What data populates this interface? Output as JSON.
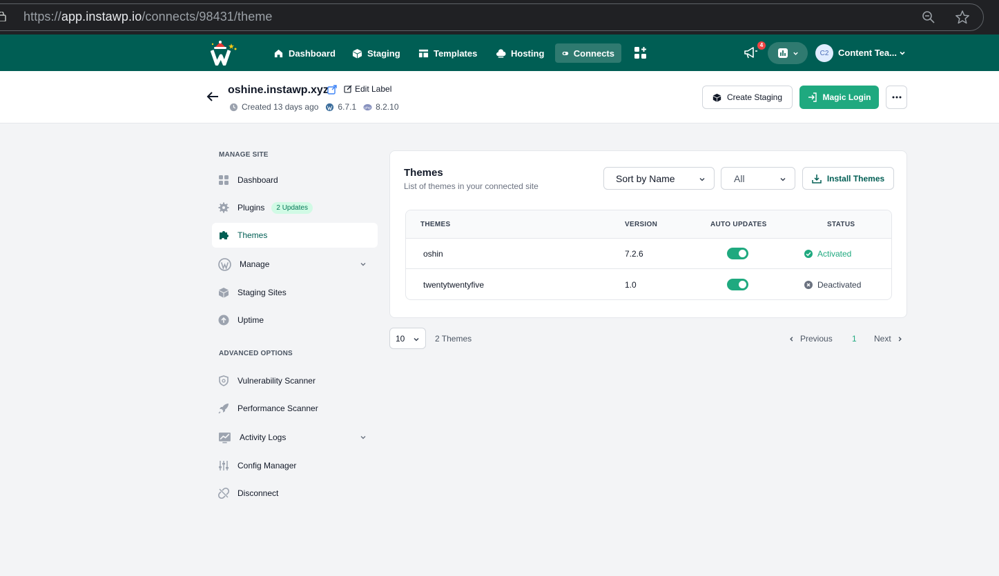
{
  "browser": {
    "url_prefix": "https://",
    "url_host": "app.instawp.io",
    "url_path": "/connects/98431/theme"
  },
  "topnav": {
    "items": [
      {
        "label": "Dashboard",
        "icon": "home-icon"
      },
      {
        "label": "Staging",
        "icon": "cube-icon"
      },
      {
        "label": "Templates",
        "icon": "template-icon"
      },
      {
        "label": "Hosting",
        "icon": "cloud-icon"
      },
      {
        "label": "Connects",
        "icon": "connects-icon",
        "active": true
      }
    ],
    "notification_count": "4",
    "avatar_initials": "C2",
    "user_name": "Content Tea..."
  },
  "site": {
    "title": "oshine.instawp.xyz",
    "edit_label": "Edit Label",
    "created": "Created 13 days ago",
    "wp_version": "6.7.1",
    "php_version": "8.2.10",
    "create_staging_label": "Create Staging",
    "magic_login_label": "Magic Login"
  },
  "sidebar": {
    "manage_heading": "MANAGE SITE",
    "manage_items": [
      {
        "label": "Dashboard",
        "icon": "grid-icon"
      },
      {
        "label": "Plugins",
        "icon": "gear-icon",
        "badge": "2 Updates"
      },
      {
        "label": "Themes",
        "icon": "puzzle-icon",
        "active": true
      },
      {
        "label": "Manage",
        "icon": "wordpress-icon",
        "expandable": true
      },
      {
        "label": "Staging Sites",
        "icon": "cube-icon"
      },
      {
        "label": "Uptime",
        "icon": "uptime-icon"
      }
    ],
    "advanced_heading": "ADVANCED OPTIONS",
    "advanced_items": [
      {
        "label": "Vulnerability Scanner",
        "icon": "shield-icon"
      },
      {
        "label": "Performance Scanner",
        "icon": "rocket-icon"
      },
      {
        "label": "Activity Logs",
        "icon": "chart-icon",
        "expandable": true
      },
      {
        "label": "Config Manager",
        "icon": "sliders-icon"
      },
      {
        "label": "Disconnect",
        "icon": "unlink-icon"
      }
    ]
  },
  "themes": {
    "title": "Themes",
    "subtitle": "List of themes in your connected site",
    "sort_value": "Sort by Name",
    "filter_value": "All",
    "install_label": "Install Themes",
    "columns": [
      "THEMES",
      "VERSION",
      "AUTO UPDATES",
      "STATUS"
    ],
    "rows": [
      {
        "name": "oshin",
        "version": "7.2.6",
        "auto_updates": true,
        "status": "Activated",
        "status_color": "#1fa97f"
      },
      {
        "name": "twentytwentyfive",
        "version": "1.0",
        "auto_updates": true,
        "status": "Deactivated",
        "status_color": "#374151"
      }
    ]
  },
  "pagination": {
    "per_page": "10",
    "count_text": "2 Themes",
    "previous": "Previous",
    "current_page": "1",
    "next": "Next"
  }
}
